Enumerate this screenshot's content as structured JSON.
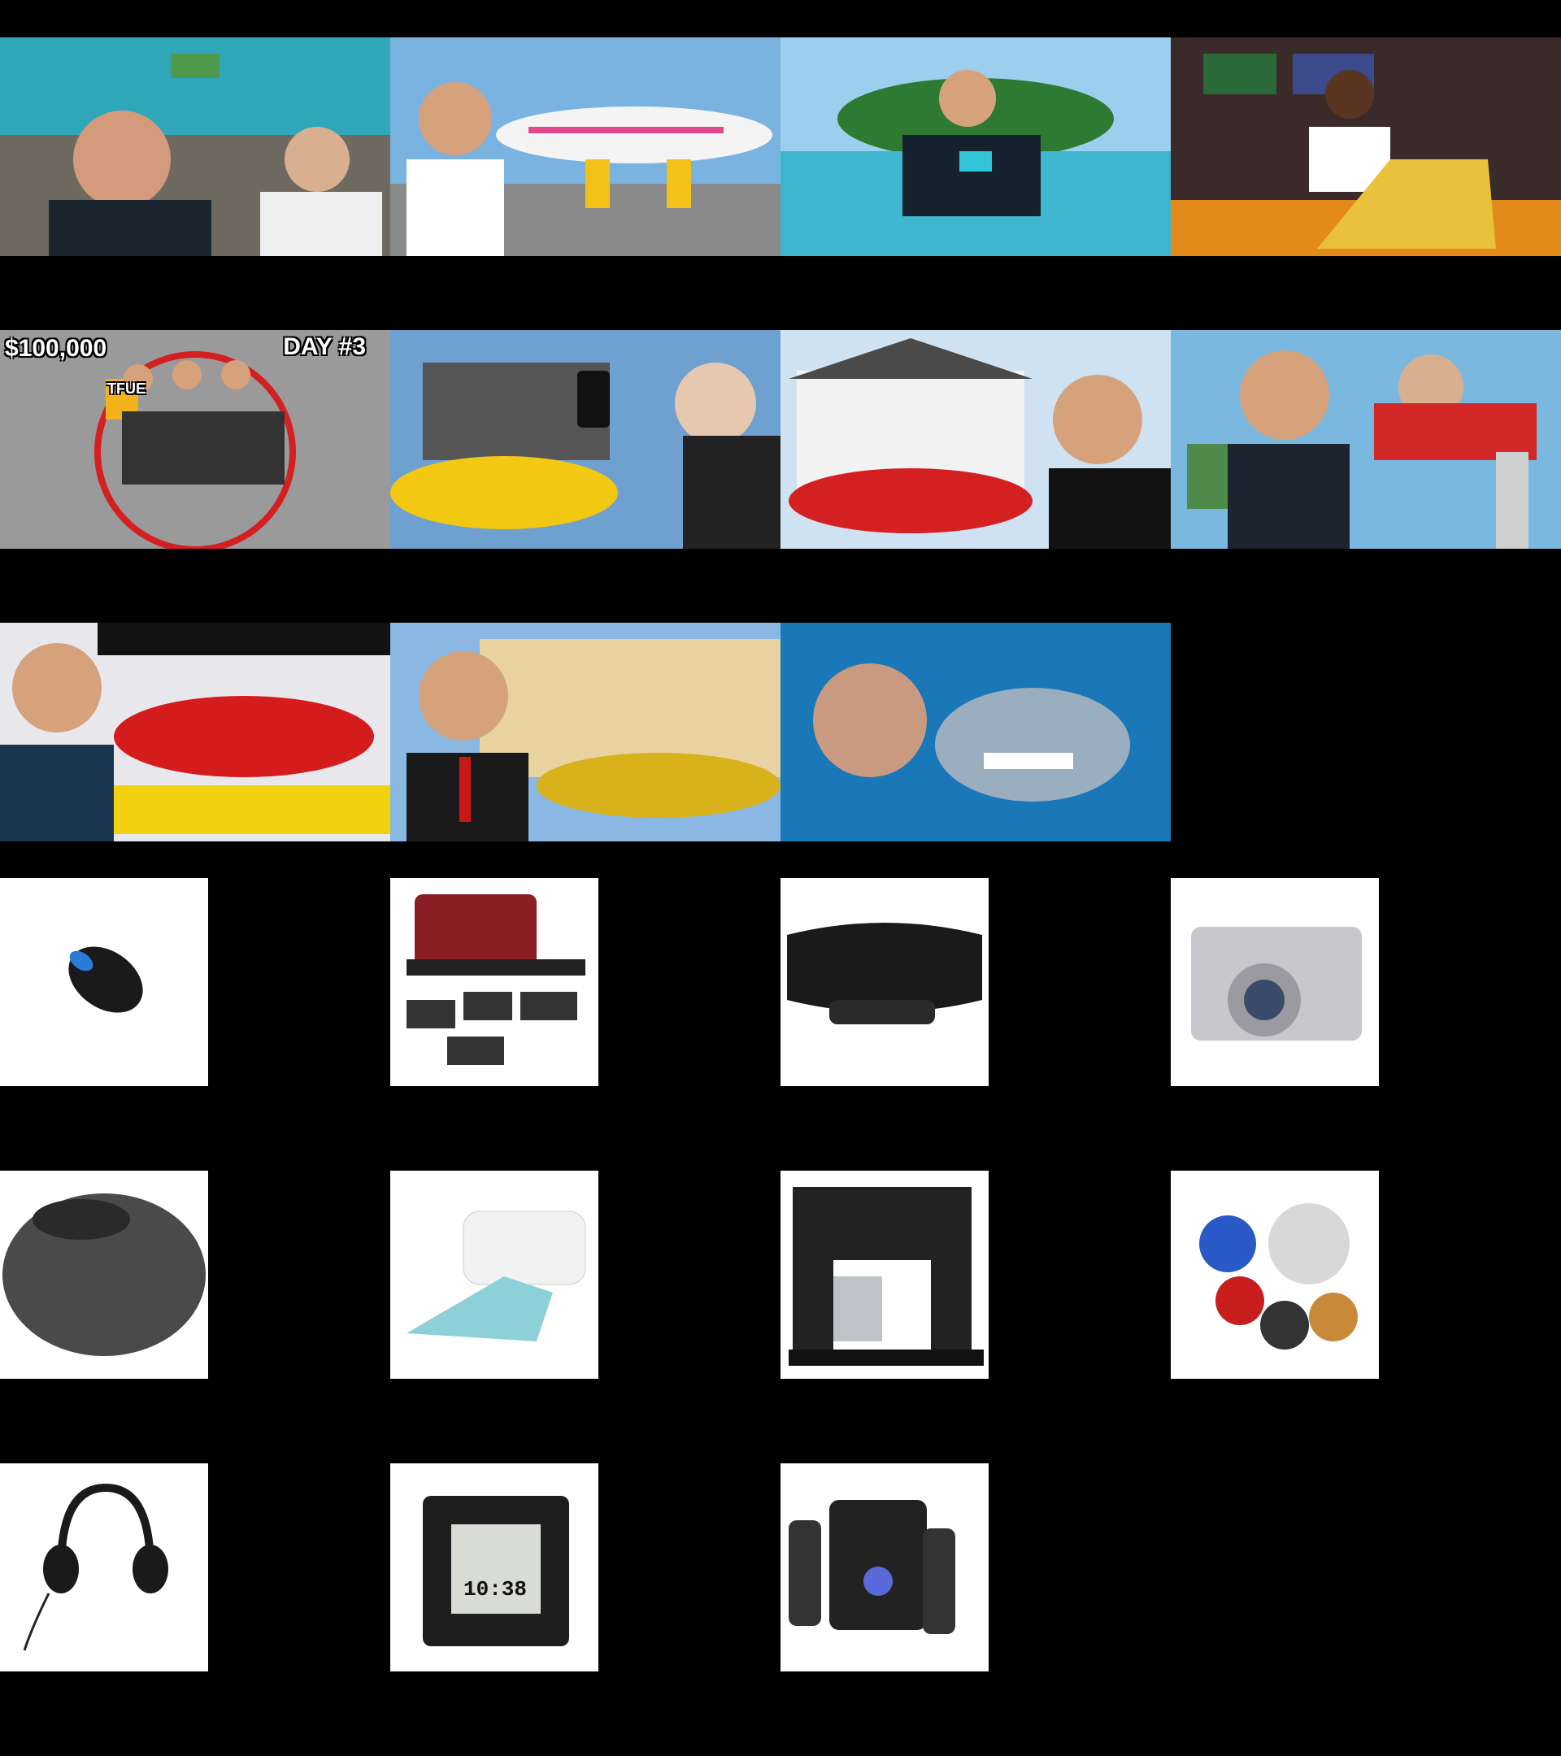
{
  "grid": {
    "video_thumbnails": [
      {
        "name": "thumb-cliff-money",
        "overlay": ""
      },
      {
        "name": "thumb-private-jet",
        "overlay": ""
      },
      {
        "name": "thumb-island",
        "overlay": ""
      },
      {
        "name": "thumb-gold-bars",
        "overlay": ""
      },
      {
        "name": "thumb-circle-challenge",
        "overlay_left": "$100,000",
        "overlay_right": "DAY #3",
        "shirt": "TFUE"
      },
      {
        "name": "thumb-lamborghini-key",
        "overlay": ""
      },
      {
        "name": "thumb-mansion-lambo",
        "overlay": ""
      },
      {
        "name": "thumb-skydive-money",
        "overlay": ""
      },
      {
        "name": "thumb-hydraulic-press",
        "overlay": ""
      },
      {
        "name": "thumb-gold-lambo-mansion",
        "overlay": ""
      },
      {
        "name": "thumb-shark",
        "overlay": ""
      }
    ],
    "product_images": [
      {
        "name": "product-mouse",
        "icon": "mouse-icon"
      },
      {
        "name": "product-grill",
        "icon": "grill-icon"
      },
      {
        "name": "product-keyboard",
        "icon": "keyboard-icon"
      },
      {
        "name": "product-camera",
        "icon": "camera-icon"
      },
      {
        "name": "product-wireless-mouse",
        "icon": "mouse-icon"
      },
      {
        "name": "product-iron",
        "icon": "iron-icon"
      },
      {
        "name": "product-coffee-maker",
        "icon": "coffee-maker-icon"
      },
      {
        "name": "product-cd-players",
        "icon": "cd-player-icon"
      },
      {
        "name": "product-headset",
        "icon": "headset-icon"
      },
      {
        "name": "product-weather-clock",
        "icon": "weather-clock-icon",
        "display": "10:38"
      },
      {
        "name": "product-speakers",
        "icon": "speaker-icon"
      }
    ]
  },
  "colors": {
    "background": "#000000"
  }
}
